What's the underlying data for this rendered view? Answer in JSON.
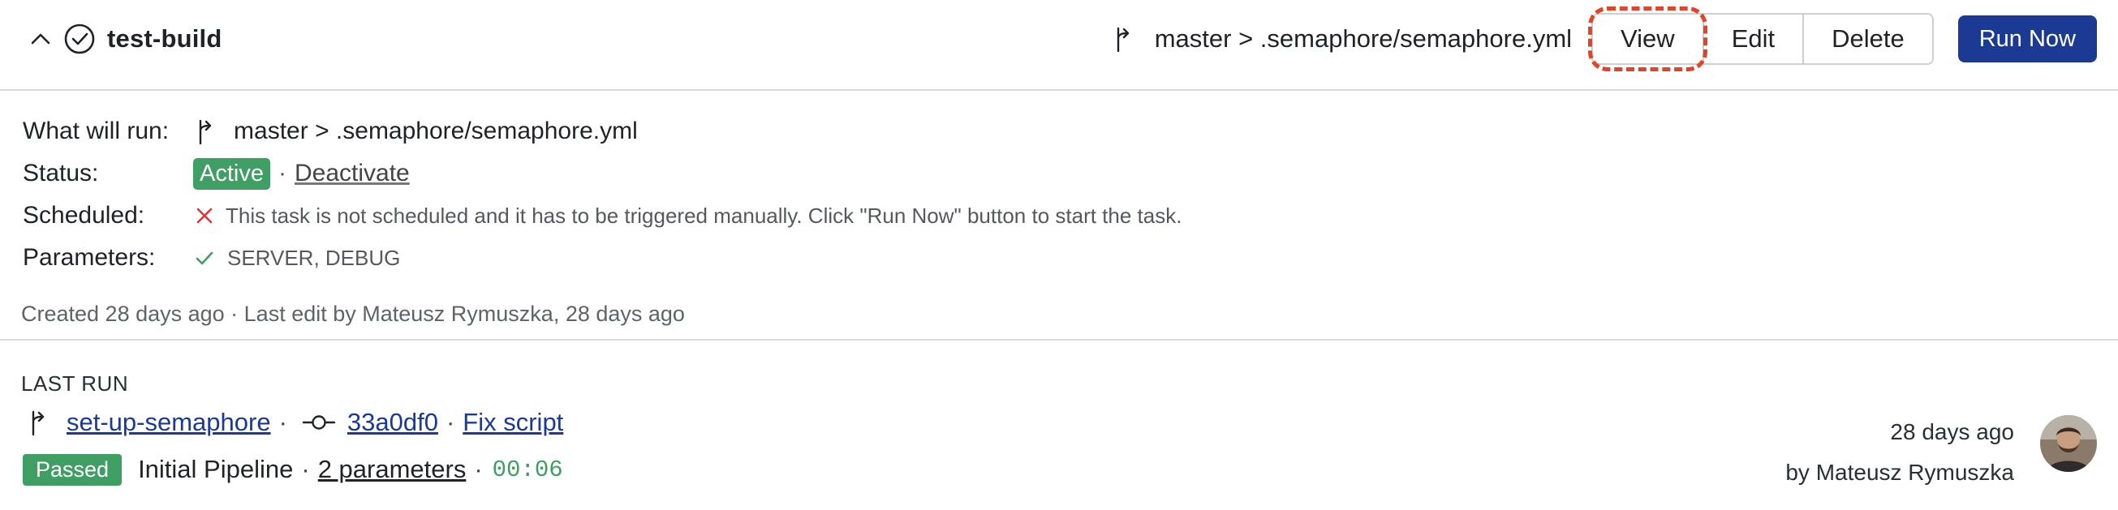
{
  "header": {
    "task_name": "test-build",
    "branch_path": "master > .semaphore/semaphore.yml",
    "buttons": {
      "view": "View",
      "edit": "Edit",
      "delete": "Delete"
    },
    "run_now": "Run Now"
  },
  "details": {
    "what_label": "What will run:",
    "what_value": "master > .semaphore/semaphore.yml",
    "status_label": "Status:",
    "status_badge": "Active",
    "status_sep": "·",
    "deactivate_link": "Deactivate",
    "scheduled_label": "Scheduled:",
    "scheduled_text": "This task is not scheduled and it has to be triggered manually. Click \"Run Now\" button to start the task.",
    "params_label": "Parameters:",
    "params_value": "SERVER, DEBUG",
    "meta": "Created 28 days ago · Last edit by Mateusz Rymuszka, 28 days ago"
  },
  "last_run": {
    "title": "LAST RUN",
    "branch": "set-up-semaphore",
    "sep": "·",
    "commit": "33a0df0",
    "commit_msg": "Fix script",
    "result_badge": "Passed",
    "pipeline": "Initial Pipeline",
    "params_link": "2 parameters",
    "duration": "00:06",
    "time_ago": "28 days ago",
    "by_user": "by Mateusz Rymuszka"
  },
  "colors": {
    "accent": "#1b3a94",
    "success": "#3e9e63",
    "highlight": "#e0442b",
    "error": "#d73a3a"
  }
}
